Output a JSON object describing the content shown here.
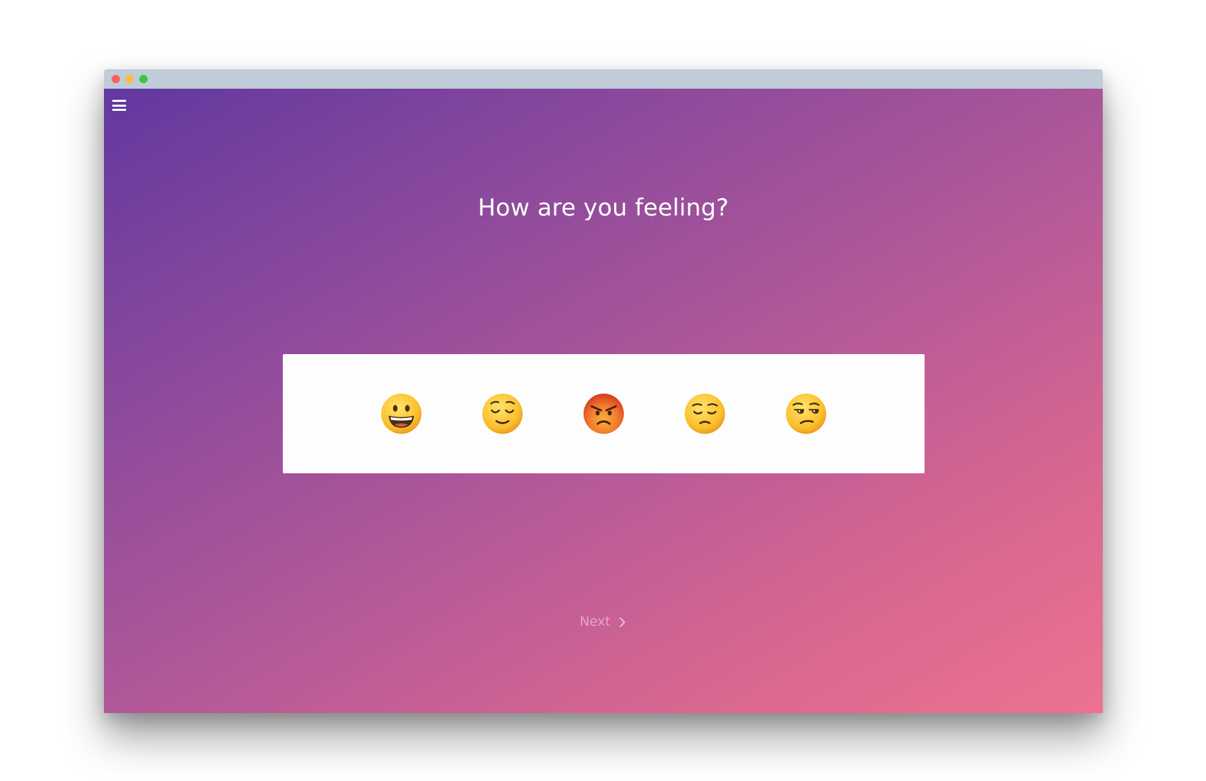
{
  "window": {
    "controls": [
      "close",
      "minimize",
      "maximize"
    ]
  },
  "menu": {
    "icon": "hamburger-menu-icon"
  },
  "survey": {
    "question": "How are you feeling?",
    "options": [
      {
        "name": "grinning-face-icon"
      },
      {
        "name": "relieved-face-icon"
      },
      {
        "name": "angry-face-icon"
      },
      {
        "name": "pensive-face-icon"
      },
      {
        "name": "unamused-face-icon"
      }
    ],
    "next_label": "Next",
    "next_icon": "chevron-right-icon"
  },
  "colors": {
    "gradient_start": "#6238a0",
    "gradient_end": "#ed7290",
    "titlebar": "#c0ccd8"
  }
}
